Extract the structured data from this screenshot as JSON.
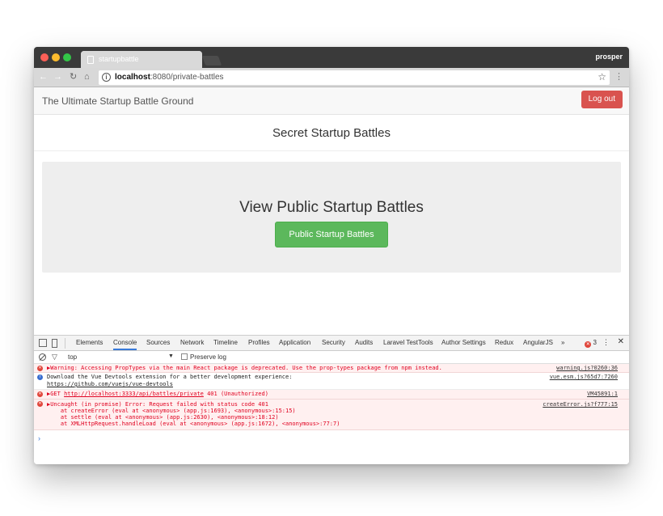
{
  "browser": {
    "tab_title": "startupbattle",
    "profile": "prosper",
    "url_host": "localhost",
    "url_rest": ":8080/private-battles"
  },
  "app": {
    "brand": "The Ultimate Startup Battle Ground",
    "logout_label": "Log out",
    "page_title": "Secret Startup Battles",
    "jumbotron_title": "View Public Startup Battles",
    "public_button_label": "Public Startup Battles"
  },
  "devtools": {
    "tabs": [
      "Elements",
      "Console",
      "Sources",
      "Network",
      "Timeline",
      "Profiles",
      "Application",
      "Security",
      "Audits",
      "Laravel TestTools",
      "Author Settings",
      "Redux",
      "AngularJS"
    ],
    "active_tab": "Console",
    "more": "»",
    "error_count": "3",
    "context": "top",
    "preserve_log": "Preserve log",
    "logs": [
      {
        "type": "error",
        "text": "▶Warning: Accessing PropTypes via the main React package is deprecated. Use the prop-types package from npm instead.",
        "source": "warning.js?0260:36"
      },
      {
        "type": "info",
        "line1": "Download the Vue Devtools extension for a better development experience:",
        "line2": "https://github.com/vuejs/vue-devtools",
        "source": "vue.esm.js?65d7:7260"
      },
      {
        "type": "error",
        "prefix": "▶GET ",
        "link": "http://localhost:3333/api/battles/private",
        "suffix": " 401 (Unauthorized)",
        "source": "VM45891:1"
      },
      {
        "type": "error",
        "lines": [
          "▶Uncaught (in promise) Error: Request failed with status code 401",
          "    at createError (eval at <anonymous> (app.js:1693), <anonymous>:15:15)",
          "    at settle (eval at <anonymous> (app.js:2630), <anonymous>:18:12)",
          "    at XMLHttpRequest.handleLoad (eval at <anonymous> (app.js:1672), <anonymous>:77:7)"
        ],
        "source": "createError.js?f777:15"
      }
    ],
    "prompt": "›"
  }
}
